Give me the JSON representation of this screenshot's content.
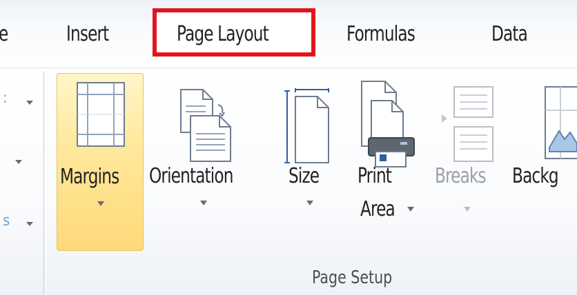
{
  "tabs": {
    "partial": "e",
    "insert": "Insert",
    "page_layout": "Page Layout",
    "formulas": "Formulas",
    "data": "Data"
  },
  "ribbon": {
    "group_label": "Page Setup",
    "buttons": {
      "margins": "Margins",
      "orientation": "Orientation",
      "size": "Size",
      "print_line1": "Print",
      "print_line2": "Area",
      "breaks": "Breaks",
      "background": "Backg"
    },
    "left_fragment_3": "s"
  },
  "icons": [
    "margins-icon",
    "orientation-icon",
    "size-icon",
    "print-area-icon",
    "breaks-icon",
    "background-icon"
  ],
  "colors": {
    "highlight_box": "#e3141c",
    "hover_fill": "#ffe79a",
    "disabled_text": "#9aa0a8"
  }
}
